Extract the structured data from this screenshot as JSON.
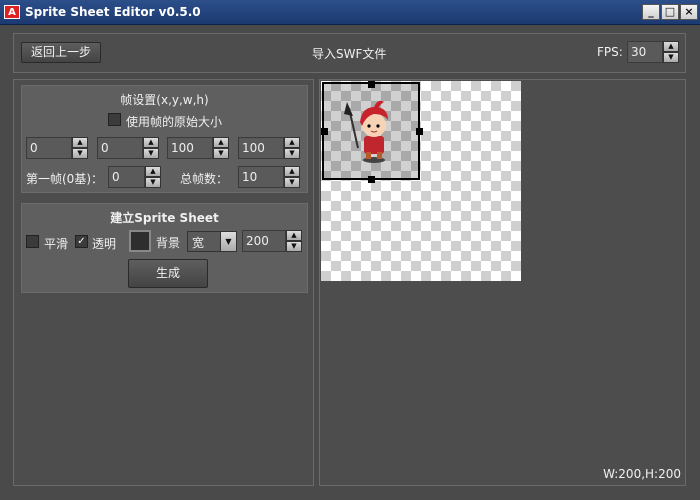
{
  "window": {
    "title": "Sprite Sheet Editor v0.5.0",
    "minimize": "_",
    "maximize": "□",
    "close": "×"
  },
  "toolbar": {
    "back_label": "返回上一步",
    "import_label": "导入SWF文件",
    "fps_label": "FPS:",
    "fps_value": "30"
  },
  "frame_settings": {
    "title": "帧设置(x,y,w,h)",
    "use_original_size_label": "使用帧的原始大小",
    "use_original_size_checked": false,
    "x": "0",
    "y": "0",
    "w": "100",
    "h": "100",
    "first_frame_label": "第一帧(0基)：",
    "first_frame_value": "0",
    "total_frames_label": "总帧数：",
    "total_frames_value": "10"
  },
  "build": {
    "title": "建立Sprite Sheet",
    "smooth_label": "平滑",
    "smooth_checked": false,
    "transparent_label": "透明",
    "transparent_checked": true,
    "background_label": "背景",
    "width_mode": "宽",
    "width_value": "200",
    "generate_label": "生成",
    "background_color": "#2e2e2e"
  },
  "canvas": {
    "dimensions_label": "W:200,H:200"
  },
  "icons": {
    "checkmark": "✓",
    "up_arrow": "▲",
    "down_arrow": "▼"
  }
}
